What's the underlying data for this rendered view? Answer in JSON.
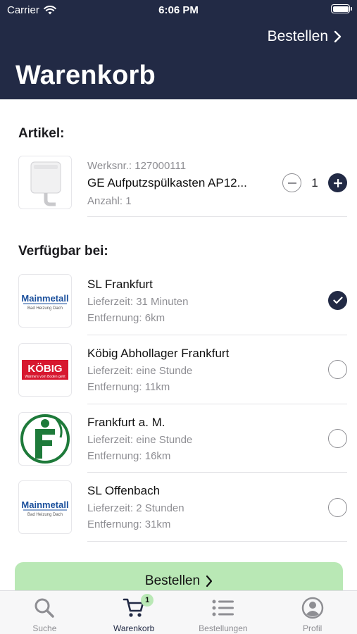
{
  "status_bar": {
    "carrier": "Carrier",
    "time": "6:06 PM"
  },
  "nav": {
    "order_label": "Bestellen",
    "title": "Warenkorb"
  },
  "articles": {
    "section_title": "Artikel:",
    "item": {
      "werksnr": "Werksnr.: 127000111",
      "name": "GE Aufputzspülkasten AP12...",
      "count": "Anzahl: 1",
      "quantity": "1"
    }
  },
  "availability": {
    "section_title": "Verfügbar bei:",
    "stores": [
      {
        "name": "SL Frankfurt",
        "delivery": "Lieferzeit: 31 Minuten",
        "distance": "Entfernung: 6km",
        "logo_text": "Mainmetall",
        "logo_sub": "Bad  Heizung  Dach",
        "selected": true
      },
      {
        "name": "Köbig Abhollager Frankfurt",
        "delivery": "Lieferzeit: eine Stunde",
        "distance": "Entfernung: 11km",
        "logo_text": "KÖBIG",
        "logo_sub": "Wärme's vom Boden geht",
        "selected": false
      },
      {
        "name": "Frankfurt a. M.",
        "delivery": "Lieferzeit: eine Stunde",
        "distance": "Entfernung: 16km",
        "logo_text": "F",
        "selected": false
      },
      {
        "name": "SL Offenbach",
        "delivery": "Lieferzeit: 2 Stunden",
        "distance": "Entfernung: 31km",
        "logo_text": "Mainmetall",
        "logo_sub": "Bad  Heizung  Dach",
        "selected": false
      }
    ]
  },
  "order_button": {
    "label": "Bestellen"
  },
  "tabbar": {
    "tabs": [
      {
        "label": "Suche",
        "icon": "search-icon"
      },
      {
        "label": "Warenkorb",
        "icon": "cart-icon",
        "badge": "1",
        "active": true
      },
      {
        "label": "Bestellungen",
        "icon": "list-icon"
      },
      {
        "label": "Profil",
        "icon": "profile-icon"
      }
    ]
  },
  "colors": {
    "primary": "#222a45",
    "accent_green": "#b9e8b5",
    "secondary_text": "#8e8e93",
    "koebig_red": "#d7172f",
    "mainmetall_blue": "#1a4f9c",
    "frankfurt_green": "#1e7a3a"
  }
}
